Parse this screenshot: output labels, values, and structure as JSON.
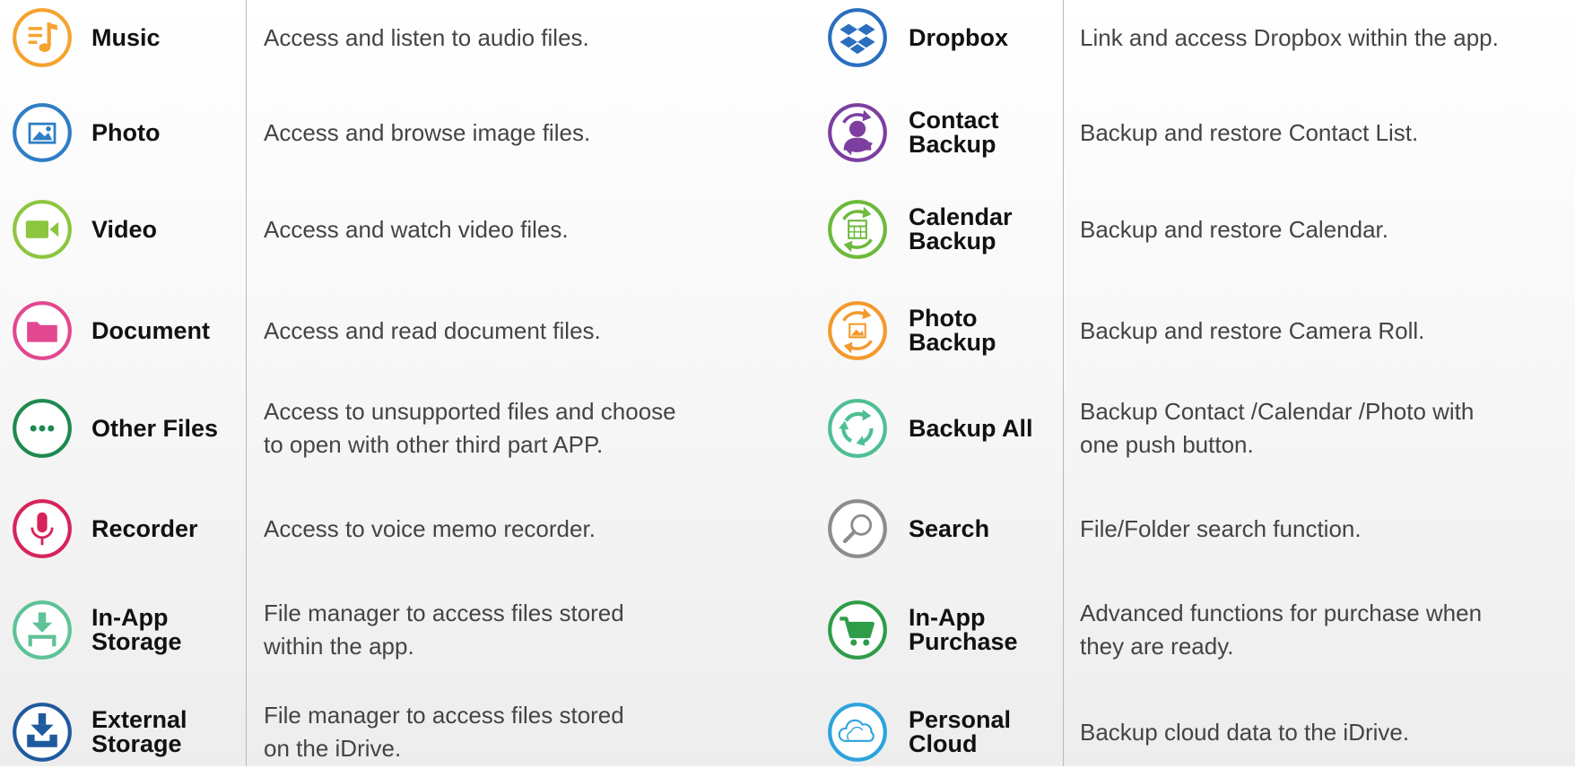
{
  "colors": {
    "music": "#f5a330",
    "photo": "#2f7ec5",
    "video": "#8cc63f",
    "document": "#e2488f",
    "other_files": "#1d8a4f",
    "recorder": "#d6245a",
    "in_app_storage": "#5ec296",
    "external_storage": "#1f5a9e",
    "dropbox": "#2a6ebf",
    "contact_backup": "#7c3fa0",
    "calendar_backup": "#6dba3c",
    "photo_backup": "#f39a2d",
    "backup_all": "#4ebf93",
    "search": "#8c8c8c",
    "in_app_purchase": "#2e9c48",
    "personal_cloud": "#2ba3dd"
  },
  "left": [
    {
      "icon": "music-note-icon",
      "label": "Music",
      "desc": "Access and listen to audio files."
    },
    {
      "icon": "image-icon",
      "label": "Photo",
      "desc": "Access and browse image files."
    },
    {
      "icon": "video-camera-icon",
      "label": "Video",
      "desc": "Access and watch video files."
    },
    {
      "icon": "folder-icon",
      "label": "Document",
      "desc": "Access and read document files."
    },
    {
      "icon": "more-dots-icon",
      "label": "Other Files",
      "desc": "Access to unsupported files and choose\nto open with other third part APP."
    },
    {
      "icon": "microphone-icon",
      "label": "Recorder",
      "desc": "Access to voice memo recorder."
    },
    {
      "icon": "download-tray-icon",
      "label": "In-App\nStorage",
      "desc": "File manager to access files stored\nwithin the app."
    },
    {
      "icon": "download-drive-icon",
      "label": "External\nStorage",
      "desc": "File manager to access files stored\non the iDrive."
    }
  ],
  "right": [
    {
      "icon": "dropbox-icon",
      "label": "Dropbox",
      "desc": "Link and access Dropbox within the app."
    },
    {
      "icon": "contact-backup-icon",
      "label": "Contact\nBackup",
      "desc": "Backup and restore Contact List."
    },
    {
      "icon": "calendar-backup-icon",
      "label": "Calendar\nBackup",
      "desc": "Backup and restore Calendar."
    },
    {
      "icon": "photo-backup-icon",
      "label": "Photo\nBackup",
      "desc": "Backup and restore Camera Roll."
    },
    {
      "icon": "backup-all-icon",
      "label": "Backup All",
      "desc": "Backup Contact /Calendar /Photo with\none push button."
    },
    {
      "icon": "search-icon",
      "label": "Search",
      "desc": "File/Folder search function."
    },
    {
      "icon": "shopping-cart-icon",
      "label": "In-App\nPurchase",
      "desc": "Advanced functions for purchase when\nthey are ready."
    },
    {
      "icon": "cloud-icon",
      "label": "Personal\nCloud",
      "desc": "Backup cloud data to the iDrive."
    }
  ]
}
